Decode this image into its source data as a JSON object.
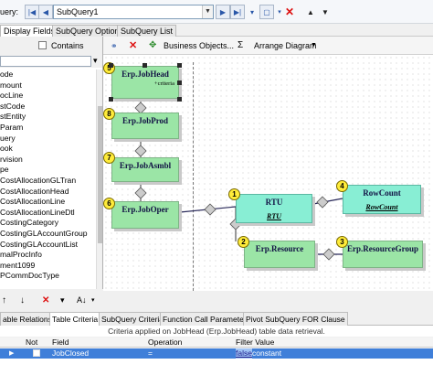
{
  "toolbar": {
    "query_label": "uery:",
    "subquery_value": "SubQuery1"
  },
  "tabs": [
    "Display Fields",
    "SubQuery Options",
    "SubQuery List"
  ],
  "left": {
    "contains_label": "Contains",
    "fields": [
      "ode",
      "mount",
      "ocLine",
      "stCode",
      "stEntity",
      "Param",
      "uery",
      "ook",
      "rvision",
      "pe",
      "CostAllocationGLTran",
      "CostAllocationHead",
      "CostAllocationLine",
      "CostAllocationLineDtl",
      "CostingCategory",
      "CostingGLAccountGroup",
      "CostingGLAccountList",
      "malProcInfo",
      "ment1099",
      "PCommDocType"
    ]
  },
  "diagram_toolbar": {
    "business_objects": "Business Objects...",
    "sigma": "Σ",
    "arrange": "Arrange Diagram"
  },
  "nodes": {
    "n5": {
      "badge": "5",
      "title": "Erp.JobHead",
      "sub": "+criteria"
    },
    "n8": {
      "badge": "8",
      "title": "Erp.JobProd"
    },
    "n7": {
      "badge": "7",
      "title": "Erp.JobAsmbl"
    },
    "n6": {
      "badge": "6",
      "title": "Erp.JobOper"
    },
    "n1": {
      "badge": "1",
      "title": "RTU",
      "sub": "RTU"
    },
    "n4": {
      "badge": "4",
      "title": "RowCount",
      "sub": "RowCount"
    },
    "n2": {
      "badge": "2",
      "title": "Erp.Resource"
    },
    "n3": {
      "badge": "3",
      "title": "Erp.ResourceGroup"
    }
  },
  "bottom_tabs": [
    "able Relations",
    "Table Criteria",
    "SubQuery Criteria",
    "Function Call Parameters",
    "Pivot SubQuery FOR Clause"
  ],
  "criteria_text": "Criteria applied on JobHead (Erp.JobHead) table data retrieval.",
  "grid": {
    "headers": {
      "not": "Not",
      "field": "Field",
      "operation": "Operation",
      "filter": "Filter Value"
    },
    "row": {
      "field": "JobClosed",
      "operation": "=",
      "filter_link": "false",
      "filter_type": "constant"
    }
  },
  "colors": {
    "node_green": "#9be5a6",
    "node_teal": "#88eed4",
    "badge": "#ffec3a",
    "selected_row": "#3f7fd9"
  }
}
